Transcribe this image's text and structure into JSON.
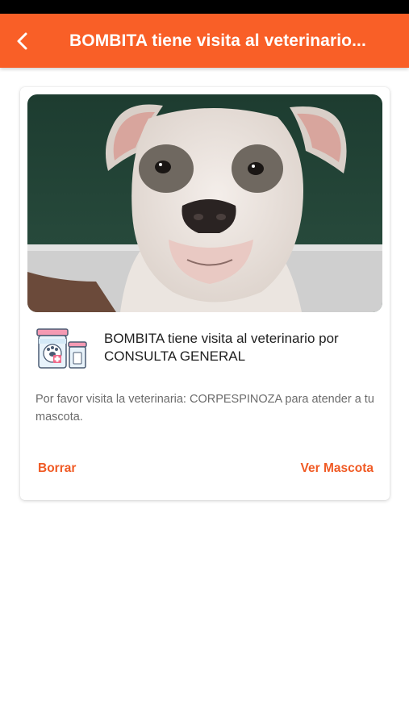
{
  "header": {
    "back_icon": "back-arrow-icon",
    "title": "BOMBITA tiene visita al veterinario..."
  },
  "card": {
    "photo": "dog-photo",
    "icon": "veterinary-medicine-icon",
    "title": "BOMBITA tiene visita al veterinario por CONSULTA GENERAL",
    "body": "Por favor visita la veterinaria: CORPESPINOZA para atender a tu mascota.",
    "delete_label": "Borrar",
    "view_label": "Ver Mascota"
  },
  "colors": {
    "accent": "#f95f27",
    "button_text": "#f05a24",
    "status_bar": "#000000"
  }
}
